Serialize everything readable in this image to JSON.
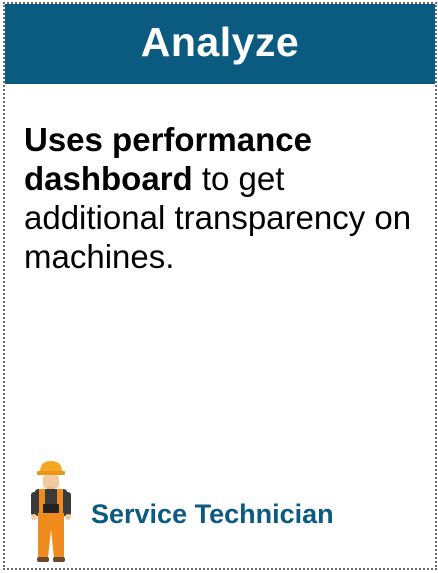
{
  "card": {
    "header_title": "Analyze",
    "description_bold": "Uses performance dashboard",
    "description_rest": " to get additional transparency on machines.",
    "role_label": "Service Technician",
    "role_icon": "service-technician-icon"
  },
  "colors": {
    "header_background": "#0b5a80",
    "header_text": "#ffffff",
    "role_text": "#0b5a80",
    "helmet": "#f5a623",
    "vest": "#f08c1e",
    "body_text": "#000000"
  }
}
